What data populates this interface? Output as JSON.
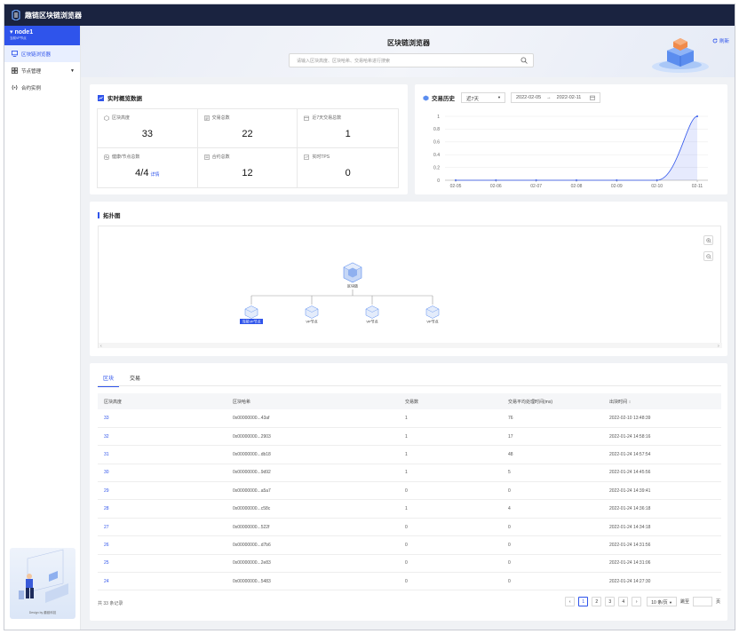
{
  "app": {
    "title": "趣链区块链浏览器"
  },
  "sidebar": {
    "node_name": "node1",
    "node_sub": "当前VP节点",
    "items": [
      {
        "label": "区块链浏览器",
        "active": true
      },
      {
        "label": "节点管理",
        "active": false
      },
      {
        "label": "合约实例",
        "active": false
      }
    ],
    "illustration_caption": "Design by 趣链科技"
  },
  "hero": {
    "title": "区块链浏览器",
    "search_placeholder": "请输入区块高度、区块哈希、交易哈希进行搜索",
    "refresh_label": "刷新"
  },
  "overview": {
    "title": "实时概览数据",
    "stats": [
      {
        "label": "区块高度",
        "value": "33"
      },
      {
        "label": "交易总数",
        "value": "22"
      },
      {
        "label": "近7天交易总数",
        "value": "1"
      },
      {
        "label": "健康/节点总数",
        "value": "4/4",
        "link": "详情"
      },
      {
        "label": "合约总数",
        "value": "12"
      },
      {
        "label": "实时TPS",
        "value": "0"
      }
    ]
  },
  "history": {
    "title": "交易历史",
    "period": "近7天",
    "date_from": "2022-02-05",
    "date_to": "2022-02-11"
  },
  "chart_data": {
    "type": "area",
    "categories": [
      "02-05",
      "02-06",
      "02-07",
      "02-08",
      "02-09",
      "02-10",
      "02-11"
    ],
    "values": [
      0,
      0,
      0,
      0,
      0,
      0,
      1
    ],
    "y_ticks": [
      "0",
      "0.2",
      "0.4",
      "0.6",
      "0.8",
      "1"
    ],
    "ylim": [
      0,
      1
    ],
    "grid": true,
    "color": "#2f54eb"
  },
  "topology": {
    "title": "拓扑图",
    "root_label": "区块链",
    "nodes": [
      "当前VP节点",
      "VP节点",
      "VP节点",
      "VP节点"
    ]
  },
  "table": {
    "tabs": [
      "区块",
      "交易"
    ],
    "headers": [
      "区块高度",
      "区块哈希",
      "交易数",
      "交易平均处理时间(ms)",
      "出块时间"
    ],
    "rows": [
      [
        "33",
        "0x00000000...43af",
        "1",
        "76",
        "2022-02-10 13:48:39"
      ],
      [
        "32",
        "0x00000000...2903",
        "1",
        "17",
        "2022-01-24 14:58:16"
      ],
      [
        "31",
        "0x00000000...db18",
        "1",
        "48",
        "2022-01-24 14:57:54"
      ],
      [
        "30",
        "0x00000000...9d92",
        "1",
        "5",
        "2022-01-24 14:45:56"
      ],
      [
        "29",
        "0x00000000...a5a7",
        "0",
        "0",
        "2022-01-24 14:39:41"
      ],
      [
        "28",
        "0x00000000...c58c",
        "1",
        "4",
        "2022-01-24 14:36:18"
      ],
      [
        "27",
        "0x00000000...522f",
        "0",
        "0",
        "2022-01-24 14:34:18"
      ],
      [
        "26",
        "0x00000000...d7b6",
        "0",
        "0",
        "2022-01-24 14:31:56"
      ],
      [
        "25",
        "0x00000000...2e83",
        "0",
        "0",
        "2022-01-24 14:31:06"
      ],
      [
        "24",
        "0x00000000...5483",
        "0",
        "0",
        "2022-01-24 14:27:30"
      ]
    ],
    "total": "共 33 条记录",
    "pages": [
      "1",
      "2",
      "3",
      "4"
    ],
    "page_size": "10 条/页",
    "jump_label": "跳至",
    "page_unit": "页"
  }
}
